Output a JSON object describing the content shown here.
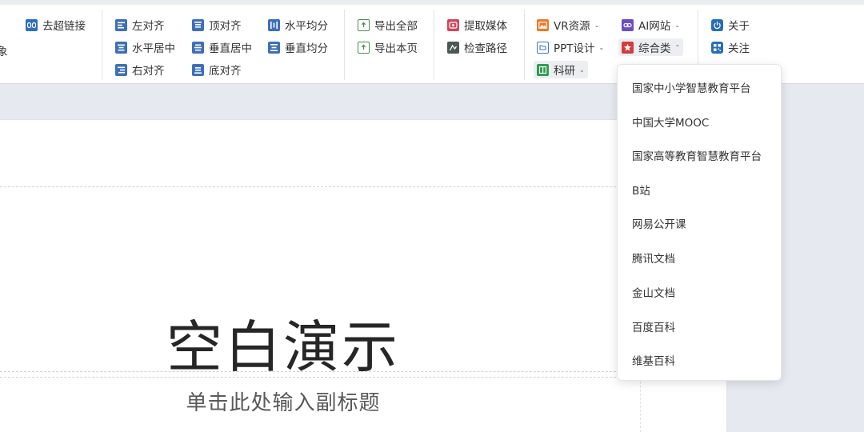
{
  "ribbon": {
    "col0": {
      "hyperlink_remove": "去超链接",
      "partial_label": "象"
    },
    "align": {
      "left": "左对齐",
      "hcenter": "水平居中",
      "right": "右对齐",
      "top": "顶对齐",
      "vcenter": "垂直居中",
      "bottom": "底对齐",
      "hdistribute": "水平均分",
      "vdistribute": "垂直均分"
    },
    "export": {
      "all": "导出全部",
      "page": "导出本页"
    },
    "media": {
      "extract": "提取媒体",
      "check_path": "检查路径"
    },
    "resources": {
      "vr": "VR资源",
      "ppt": "PPT设计",
      "research": "科研",
      "ai": "AI网站",
      "general": "综合类"
    },
    "about": {
      "about": "关于",
      "follow": "关注"
    }
  },
  "slide": {
    "title": "空白演示",
    "subtitle": "单击此处输入副标题"
  },
  "dropdown": {
    "items": [
      "国家中小学智慧教育平台",
      "中国大学MOOC",
      "国家高等教育智慧教育平台",
      "B站",
      "网易公开课",
      "腾讯文档",
      "金山文档",
      "百度百科",
      "维基百科"
    ]
  },
  "colors": {
    "align_icon": "#3e6fb7",
    "export_icon": "#4e8a4f",
    "media_icon": "#d0465a",
    "path_icon": "#4a5a52",
    "vr_icon": "#ea7a2b",
    "ppt_icon": "#3f78c8",
    "research_icon": "#2e9a52",
    "ai_icon": "#6e4dc1",
    "general_icon": "#d23c3c",
    "about_icon": "#2a6cb4"
  }
}
